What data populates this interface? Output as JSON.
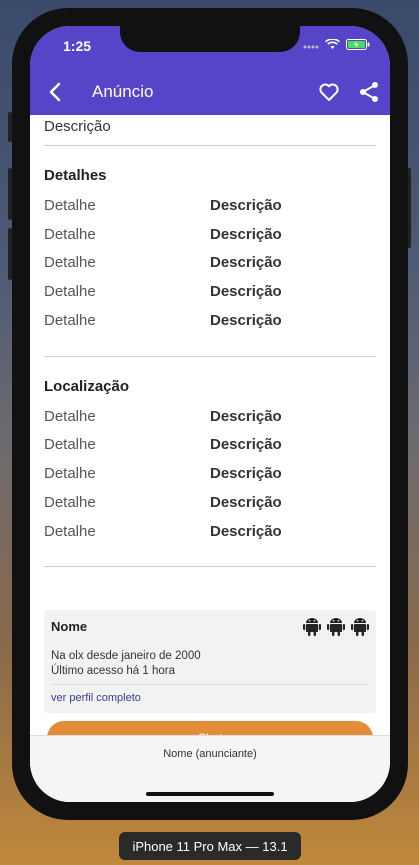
{
  "status": {
    "time": "1:25"
  },
  "appbar": {
    "title": "Anúncio",
    "back_icon": "back-arrow-icon",
    "heart_icon": "heart-icon",
    "share_icon": "share-icon"
  },
  "main": {
    "top_description": "Descrição",
    "details": {
      "title": "Detalhes",
      "rows": [
        {
          "label": "Detalhe",
          "value": "Descrição"
        },
        {
          "label": "Detalhe",
          "value": "Descrição"
        },
        {
          "label": "Detalhe",
          "value": "Descrição"
        },
        {
          "label": "Detalhe",
          "value": "Descrição"
        },
        {
          "label": "Detalhe",
          "value": "Descrição"
        }
      ]
    },
    "location": {
      "title": "Localização",
      "rows": [
        {
          "label": "Detalhe",
          "value": "Descrição"
        },
        {
          "label": "Detalhe",
          "value": "Descrição"
        },
        {
          "label": "Detalhe",
          "value": "Descrição"
        },
        {
          "label": "Detalhe",
          "value": "Descrição"
        },
        {
          "label": "Detalhe",
          "value": "Descrição"
        }
      ]
    },
    "seller": {
      "name": "Nome",
      "since": "Na olx desde janeiro de 2000",
      "last_access": "Último acesso há 1 hora",
      "profile_link": "ver perfil completo",
      "icons": [
        "android-icon",
        "android-icon",
        "android-icon"
      ]
    },
    "chat_label": "Chat"
  },
  "bottom": {
    "label": "Nome (anunciante)"
  },
  "device_label": "iPhone 11 Pro Max — 13.1",
  "colors": {
    "appbar": "#5644c9",
    "chat": "#e38d3a",
    "link": "#3a3aa0"
  }
}
